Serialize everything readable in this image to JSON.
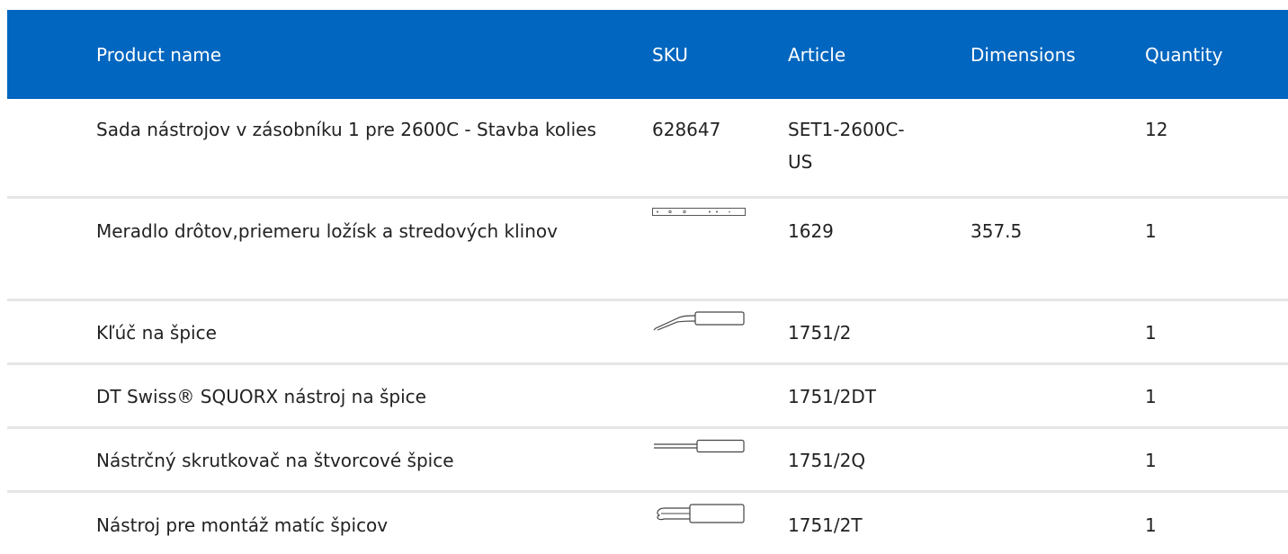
{
  "table": {
    "headers": {
      "name": "Product name",
      "sku": "SKU",
      "article": "Article",
      "dimensions": "Dimensions",
      "quantity": "Quantity"
    },
    "rows": [
      {
        "name": "Sada nástrojov v zásobníku 1 pre 2600C - Stavba kolies",
        "sku": "628647",
        "sku_icon": "",
        "article": "SET1-2600C-US",
        "dimensions": "",
        "quantity": "12"
      },
      {
        "name": "Meradlo drôtov,priemeru ložísk a stredových klinov",
        "sku": "",
        "sku_icon": "gauge-ruler-icon",
        "article": "1629",
        "dimensions": "357.5",
        "quantity": "1"
      },
      {
        "name": "Kľúč na špice",
        "sku": "",
        "sku_icon": "spoke-wrench-icon",
        "article": "1751/2",
        "dimensions": "",
        "quantity": "1"
      },
      {
        "name": "DT Swiss® SQUORX nástroj na špice",
        "sku": "",
        "sku_icon": "",
        "article": "1751/2DT",
        "dimensions": "",
        "quantity": "1"
      },
      {
        "name": "Nástrčný skrutkovač na štvorcové špice",
        "sku": "",
        "sku_icon": "square-screwdriver-icon",
        "article": "1751/2Q",
        "dimensions": "",
        "quantity": "1"
      },
      {
        "name": "Nástroj pre montáž matíc špicov",
        "sku": "",
        "sku_icon": "nipple-driver-icon",
        "article": "1751/2T",
        "dimensions": "",
        "quantity": "1"
      }
    ]
  },
  "colors": {
    "header_bg": "#0066bf",
    "header_text": "#ffffff",
    "row_divider": "#e6e6e6"
  }
}
